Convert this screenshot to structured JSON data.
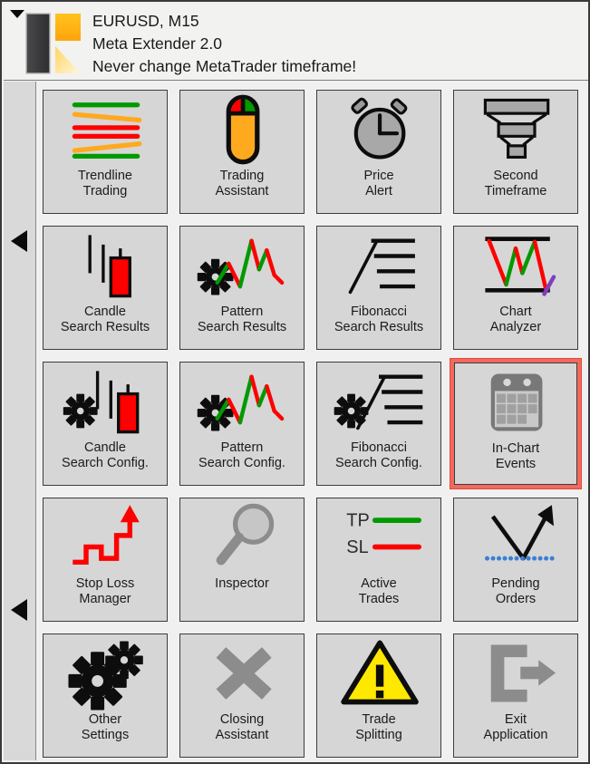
{
  "window": {
    "collapse_arrow_icon": "triangle-down-icon",
    "logo_icon": "meta-extender-logo"
  },
  "header": {
    "symbol_timeframe": "EURUSD, M15",
    "product": "Meta Extender 2.0",
    "warning": "Never change MetaTrader timeframe!"
  },
  "sidebar": {
    "scroll_left_1": "◀",
    "scroll_left_2": "◀"
  },
  "colors": {
    "tile_bg": "#d6d6d6",
    "tile_border": "#3c3c3c",
    "selection": "#f2695e",
    "accent_orange": "#ffa91e",
    "bull_green": "#009a00",
    "bear_red": "#ff0000",
    "purple": "#7d3fc0",
    "gray_icon": "#808080",
    "yellow_warn": "#ffe800",
    "dotted_blue": "#3a7fd5"
  },
  "tiles": [
    {
      "id": "trendline-trading",
      "icon": "trendlines-icon",
      "label": "Trendline\nTrading",
      "selected": false
    },
    {
      "id": "trading-assistant",
      "icon": "mouse-icon",
      "label": "Trading\nAssistant",
      "selected": false
    },
    {
      "id": "price-alert",
      "icon": "alarm-clock-icon",
      "label": "Price\nAlert",
      "selected": false
    },
    {
      "id": "second-timeframe",
      "icon": "funnel-stack-icon",
      "label": "Second\nTimeframe",
      "selected": false
    },
    {
      "id": "candle-search-results",
      "icon": "candlestick-icon",
      "label": "Candle\nSearch Results",
      "selected": false
    },
    {
      "id": "pattern-search-results",
      "icon": "gear-zigzag-icon",
      "label": "Pattern\nSearch Results",
      "selected": false
    },
    {
      "id": "fibonacci-search-results",
      "icon": "fibonacci-icon",
      "label": "Fibonacci\nSearch Results",
      "selected": false
    },
    {
      "id": "chart-analyzer",
      "icon": "chart-channel-icon",
      "label": "Chart\nAnalyzer",
      "selected": false
    },
    {
      "id": "candle-search-config",
      "icon": "gear-candlestick-icon",
      "label": "Candle\nSearch Config.",
      "selected": false
    },
    {
      "id": "pattern-search-config",
      "icon": "gear-zigzag-icon",
      "label": "Pattern\nSearch Config.",
      "selected": false
    },
    {
      "id": "fibonacci-search-config",
      "icon": "gear-fibonacci-icon",
      "label": "Fibonacci\nSearch Config.",
      "selected": false
    },
    {
      "id": "in-chart-events",
      "icon": "calendar-icon",
      "label": "In-Chart\nEvents",
      "selected": true
    },
    {
      "id": "stop-loss-manager",
      "icon": "staircase-arrow-icon",
      "label": "Stop Loss\nManager",
      "selected": false
    },
    {
      "id": "inspector",
      "icon": "magnifier-icon",
      "label": "Inspector",
      "selected": false
    },
    {
      "id": "active-trades",
      "icon": "tp-sl-lines-icon",
      "label": "Active\nTrades",
      "selected": false
    },
    {
      "id": "pending-orders",
      "icon": "pending-arrow-icon",
      "label": "Pending\nOrders",
      "selected": false
    },
    {
      "id": "other-settings",
      "icon": "double-gear-icon",
      "label": "Other\nSettings",
      "selected": false
    },
    {
      "id": "closing-assistant",
      "icon": "cross-x-icon",
      "label": "Closing\nAssistant",
      "selected": false
    },
    {
      "id": "trade-splitting",
      "icon": "warning-triangle-icon",
      "label": "Trade\nSplitting",
      "selected": false
    },
    {
      "id": "exit-application",
      "icon": "exit-arrow-icon",
      "label": "Exit\nApplication",
      "selected": false
    }
  ],
  "icon_labels": {
    "take_profit": "TP",
    "stop_loss": "SL"
  }
}
